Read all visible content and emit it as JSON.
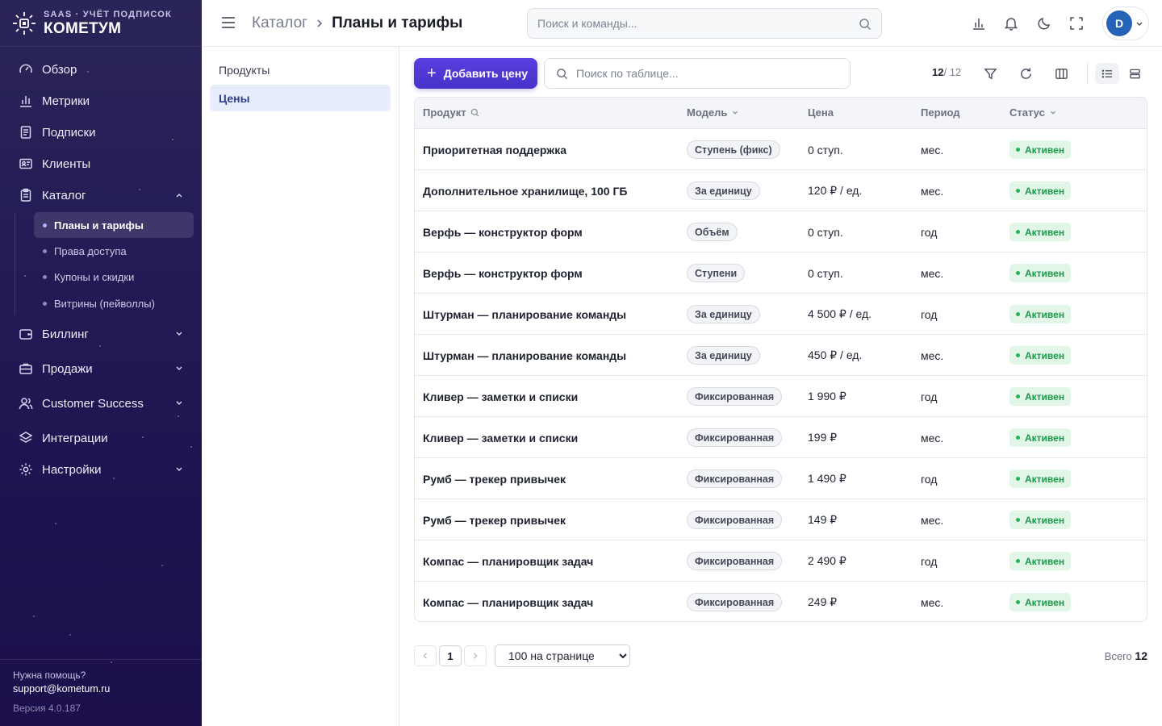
{
  "brand": {
    "subtitle": "SAAS · УЧЁТ ПОДПИСОК",
    "name": "КОМЕТУМ"
  },
  "sidebar": {
    "items": [
      {
        "label": "Обзор",
        "icon": "gauge-icon"
      },
      {
        "label": "Метрики",
        "icon": "bar-chart-icon"
      },
      {
        "label": "Подписки",
        "icon": "document-icon"
      },
      {
        "label": "Клиенты",
        "icon": "id-card-icon"
      },
      {
        "label": "Каталог",
        "icon": "clipboard-icon",
        "expanded": true
      },
      {
        "label": "Биллинг",
        "icon": "wallet-icon"
      },
      {
        "label": "Продажи",
        "icon": "briefcase-icon"
      },
      {
        "label": "Customer Success",
        "icon": "users-icon"
      },
      {
        "label": "Интеграции",
        "icon": "layers-icon"
      },
      {
        "label": "Настройки",
        "icon": "gear-icon"
      }
    ],
    "catalog_children": [
      {
        "label": "Планы и тарифы",
        "active": true
      },
      {
        "label": "Права доступа"
      },
      {
        "label": "Купоны и скидки"
      },
      {
        "label": "Витрины (пейволлы)"
      }
    ],
    "footer": {
      "help_title": "Нужна помощь?",
      "help_email": "support@kometum.ru",
      "version": "Версия 4.0.187"
    }
  },
  "header": {
    "breadcrumb": [
      "Каталог",
      "Планы и тарифы"
    ],
    "search_placeholder": "Поиск и команды...",
    "avatar_letter": "D"
  },
  "subnav": {
    "items": [
      "Продукты",
      "Цены"
    ],
    "active": "Цены"
  },
  "toolbar": {
    "add_label": "Добавить цену",
    "search_placeholder": "Поиск по таблице...",
    "count_shown": "12",
    "count_total": "/ 12"
  },
  "table": {
    "columns": [
      "Продукт",
      "Модель",
      "Цена",
      "Период",
      "Статус"
    ],
    "rows": [
      {
        "product": "Приоритетная поддержка",
        "model": "Ступень (фикс)",
        "price": "0 ступ.",
        "period": "мес.",
        "status": "Активен"
      },
      {
        "product": "Дополнительное хранилище, 100 ГБ",
        "model": "За единицу",
        "price": "120 ₽ / ед.",
        "period": "мес.",
        "status": "Активен"
      },
      {
        "product": "Верфь — конструктор форм",
        "model": "Объём",
        "price": "0 ступ.",
        "period": "год",
        "status": "Активен"
      },
      {
        "product": "Верфь — конструктор форм",
        "model": "Ступени",
        "price": "0 ступ.",
        "period": "мес.",
        "status": "Активен"
      },
      {
        "product": "Штурман — планирование команды",
        "model": "За единицу",
        "price": "4 500 ₽ / ед.",
        "period": "год",
        "status": "Активен"
      },
      {
        "product": "Штурман — планирование команды",
        "model": "За единицу",
        "price": "450 ₽ / ед.",
        "period": "мес.",
        "status": "Активен"
      },
      {
        "product": "Кливер — заметки и списки",
        "model": "Фиксированная",
        "price": "1 990 ₽",
        "period": "год",
        "status": "Активен"
      },
      {
        "product": "Кливер — заметки и списки",
        "model": "Фиксированная",
        "price": "199 ₽",
        "period": "мес.",
        "status": "Активен"
      },
      {
        "product": "Румб — трекер привычек",
        "model": "Фиксированная",
        "price": "1 490 ₽",
        "period": "год",
        "status": "Активен"
      },
      {
        "product": "Румб — трекер привычек",
        "model": "Фиксированная",
        "price": "149 ₽",
        "period": "мес.",
        "status": "Активен"
      },
      {
        "product": "Компас — планировщик задач",
        "model": "Фиксированная",
        "price": "2 490 ₽",
        "period": "год",
        "status": "Активен"
      },
      {
        "product": "Компас — планировщик задач",
        "model": "Фиксированная",
        "price": "249 ₽",
        "period": "мес.",
        "status": "Активен"
      }
    ]
  },
  "pagination": {
    "current_page": "1",
    "per_page_options": [
      "100 на странице"
    ],
    "total_label": "Всего",
    "total_value": "12"
  },
  "colors": {
    "accent": "#4f38d6",
    "status_active": "#1c9a4c",
    "sidebar_bg": "#221a55"
  }
}
